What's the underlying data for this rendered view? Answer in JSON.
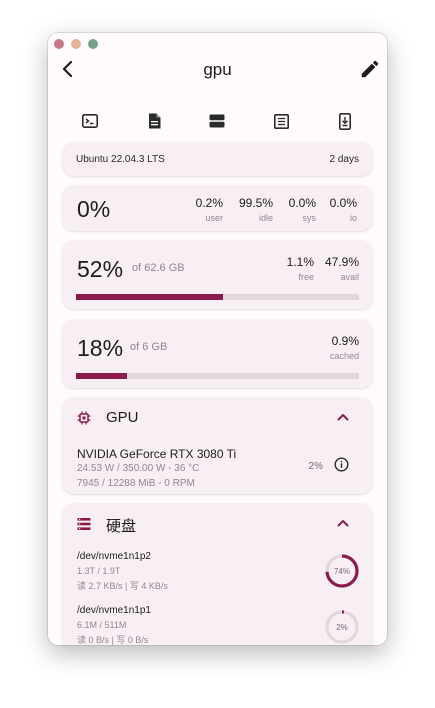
{
  "window": {
    "title": "gpu"
  },
  "toolbar": {
    "icons": [
      "terminal-icon",
      "file-icon",
      "server-icon",
      "table-icon",
      "download-device-icon"
    ]
  },
  "os": {
    "name": "Ubuntu 22.04.3 LTS",
    "uptime": "2 days"
  },
  "cpu": {
    "percent": "0%",
    "stats": [
      {
        "value": "0.2%",
        "label": "user"
      },
      {
        "value": "99.5%",
        "label": "idle"
      },
      {
        "value": "0.0%",
        "label": "sys"
      },
      {
        "value": "0.0%",
        "label": "io"
      }
    ]
  },
  "memory": {
    "percent": "52%",
    "total": "of 62.6 GB",
    "usage_fraction": 0.52,
    "stats": [
      {
        "value": "1.1%",
        "label": "free"
      },
      {
        "value": "47.9%",
        "label": "avail"
      }
    ]
  },
  "swap": {
    "percent": "18%",
    "total": "of 6 GB",
    "usage_fraction": 0.18,
    "stats": [
      {
        "value": "0.9%",
        "label": "cached"
      }
    ]
  },
  "gpu": {
    "title": "GPU",
    "name": "NVIDIA GeForce RTX 3080 Ti",
    "power": "24.53 W / 350.00 W - 36 °C",
    "memory": "7945 / 12288 MiB - 0 RPM",
    "usage": "2%"
  },
  "disk": {
    "title": "硬盘",
    "items": [
      {
        "name": "/dev/nvme1n1p2",
        "size": "1.3T / 1.9T",
        "io": "读 2.7 KB/s | 写 4 KB/s",
        "percent_label": "74%",
        "percent": 74,
        "color": "#8b1b4e"
      },
      {
        "name": "/dev/nvme1n1p1",
        "size": "6.1M / 511M",
        "io": "读 0 B/s | 写 0 B/s",
        "percent_label": "2%",
        "percent": 2,
        "color": "#8b1b4e"
      }
    ]
  },
  "colors": {
    "accent": "#8b1b4e",
    "card": "#f8eff4"
  }
}
